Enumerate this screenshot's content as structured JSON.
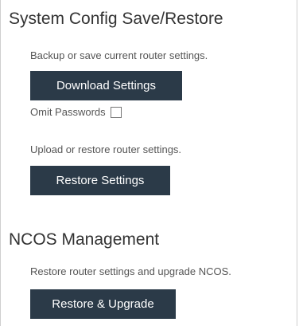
{
  "system_config": {
    "title": "System Config Save/Restore",
    "backup_description": "Backup or save current router settings.",
    "download_button": "Download Settings",
    "omit_passwords_label": "Omit Passwords",
    "omit_passwords_checked": false,
    "upload_description": "Upload or restore router settings.",
    "restore_button": "Restore Settings"
  },
  "ncos_management": {
    "title": "NCOS Management",
    "description": "Restore router settings and upgrade NCOS.",
    "restore_upgrade_button": "Restore & Upgrade"
  },
  "colors": {
    "button_bg": "#2b3a48",
    "button_text": "#ffffff",
    "border": "#cfcfcf"
  }
}
